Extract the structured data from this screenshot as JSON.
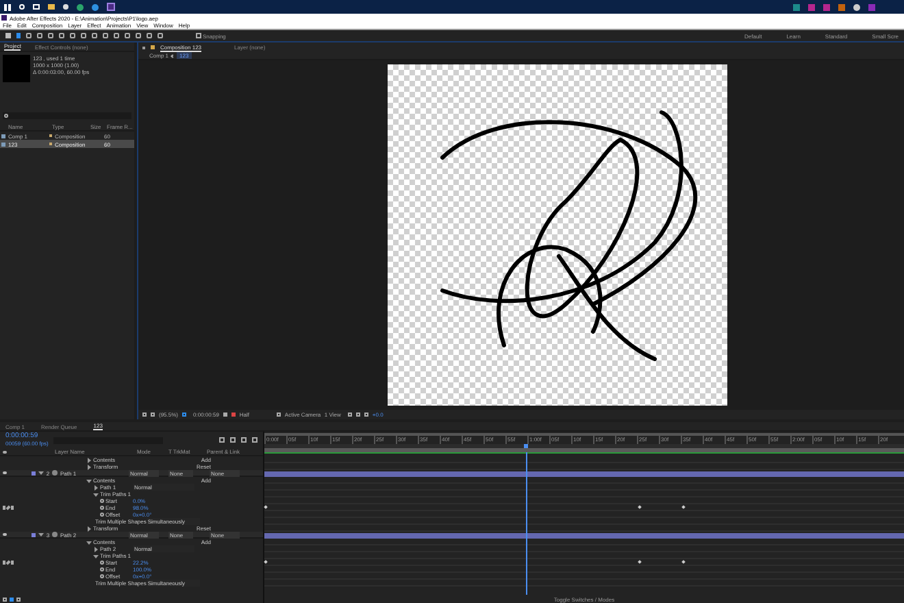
{
  "title_bar": {
    "title": "Adobe After Effects 2020 - E:\\Animation\\Projects\\P1\\logo.aep"
  },
  "menu": [
    "File",
    "Edit",
    "Composition",
    "Layer",
    "Effect",
    "Animation",
    "View",
    "Window",
    "Help"
  ],
  "toolbar": {
    "snapping": {
      "label": "Snapping",
      "checked": false
    },
    "workspaces": [
      {
        "label": "Default",
        "selected": false
      },
      {
        "label": "Learn",
        "selected": false
      },
      {
        "label": "Standard",
        "selected": false
      },
      {
        "label": "Small Scre",
        "selected": false
      }
    ]
  },
  "project": {
    "tabs": [
      {
        "label": "Project",
        "selected": true
      },
      {
        "label": "Effect Controls (none)",
        "selected": false
      }
    ],
    "info": [
      "123 , used 1 time",
      "1000 x 1000 (1.00)",
      "Δ 0:00:03:00, 60.00 fps"
    ],
    "columns": [
      "Name",
      "Type",
      "Size",
      "Frame R..."
    ],
    "items": [
      {
        "name": "Comp 1",
        "type": "Composition",
        "frame_rate": "60",
        "selected": false,
        "color": "#c8a86b"
      },
      {
        "name": "123",
        "type": "Composition",
        "frame_rate": "60",
        "selected": true,
        "color": "#c8a86b"
      }
    ]
  },
  "composition": {
    "tabs": [
      {
        "label": "Composition 123",
        "selected": true
      },
      {
        "label": "Layer (none)",
        "selected": false
      }
    ],
    "breadcrumb": [
      "Comp 1",
      "123"
    ],
    "viewer_bar": {
      "zoom": "(95.5%)",
      "time": "0:00:00:59",
      "resolution": "Half",
      "camera": "Active Camera",
      "views": "1 View",
      "exposure": "+0.0"
    }
  },
  "timeline": {
    "tabs": [
      {
        "label": "Comp 1",
        "selected": false
      },
      {
        "label": "Render Queue",
        "selected": false
      },
      {
        "label": "123",
        "selected": true
      }
    ],
    "time": "0:00:00:59",
    "frames": "00059 (60.00 fps)",
    "columns": [
      "Layer Name",
      "Mode",
      "T  TrkMat",
      "Parent & Link"
    ],
    "ruler": [
      "0:00f",
      "05f",
      "10f",
      "15f",
      "20f",
      "25f",
      "30f",
      "35f",
      "40f",
      "45f",
      "50f",
      "55f",
      "1:00f",
      "05f",
      "10f",
      "15f",
      "20f",
      "25f",
      "30f",
      "35f",
      "40f",
      "45f",
      "50f",
      "55f",
      "2:00f",
      "05f",
      "10f",
      "15f",
      "20f"
    ],
    "playhead": {
      "level": 0.41
    },
    "rows": [
      {
        "kind": "group",
        "label": "Contents",
        "action": "Add",
        "expanded": false
      },
      {
        "kind": "group",
        "label": "Transform",
        "action": "Reset",
        "expanded": false
      },
      {
        "kind": "layer",
        "number": "2",
        "name": "Path 1",
        "mode": "Normal",
        "trkmat": "None",
        "parent": "None",
        "color": "#7a7fd9",
        "expanded": true,
        "children": [
          {
            "kind": "group",
            "label": "Contents",
            "action": "Add",
            "expanded": true,
            "children": [
              {
                "kind": "group",
                "label": "Path 1",
                "value": "Normal",
                "expanded": false
              },
              {
                "kind": "group",
                "label": "Trim Paths 1",
                "expanded": true,
                "children": [
                  {
                    "kind": "property",
                    "label": "Start",
                    "value": "0.0%",
                    "keyframed": false
                  },
                  {
                    "kind": "property",
                    "label": "End",
                    "value": "98.0%",
                    "keyframed": true
                  },
                  {
                    "kind": "property",
                    "label": "Offset",
                    "value": "0x+0.0°",
                    "keyframed": false
                  },
                  {
                    "kind": "option",
                    "label": "Trim Multiple Shapes",
                    "value": "Simultaneously"
                  }
                ]
              }
            ]
          },
          {
            "kind": "group",
            "label": "Transform",
            "action": "Reset",
            "expanded": false
          }
        ]
      },
      {
        "kind": "layer",
        "number": "3",
        "name": "Path 2",
        "mode": "Normal",
        "trkmat": "None",
        "parent": "None",
        "color": "#7a7fd9",
        "expanded": true,
        "children": [
          {
            "kind": "group",
            "label": "Contents",
            "action": "Add",
            "expanded": true,
            "children": [
              {
                "kind": "group",
                "label": "Path 2",
                "value": "Normal",
                "expanded": false
              },
              {
                "kind": "group",
                "label": "Trim Paths 1",
                "expanded": true,
                "children": [
                  {
                    "kind": "property",
                    "label": "Start",
                    "value": "22.2%",
                    "keyframed": true
                  },
                  {
                    "kind": "property",
                    "label": "End",
                    "value": "100.0%",
                    "keyframed": false
                  },
                  {
                    "kind": "property",
                    "label": "Offset",
                    "value": "0x+0.0°",
                    "keyframed": false
                  },
                  {
                    "kind": "option",
                    "label": "Trim Multiple Shapes",
                    "value": "Simultaneously"
                  }
                ]
              }
            ]
          }
        ]
      }
    ],
    "footer": "Toggle Switches / Modes"
  }
}
